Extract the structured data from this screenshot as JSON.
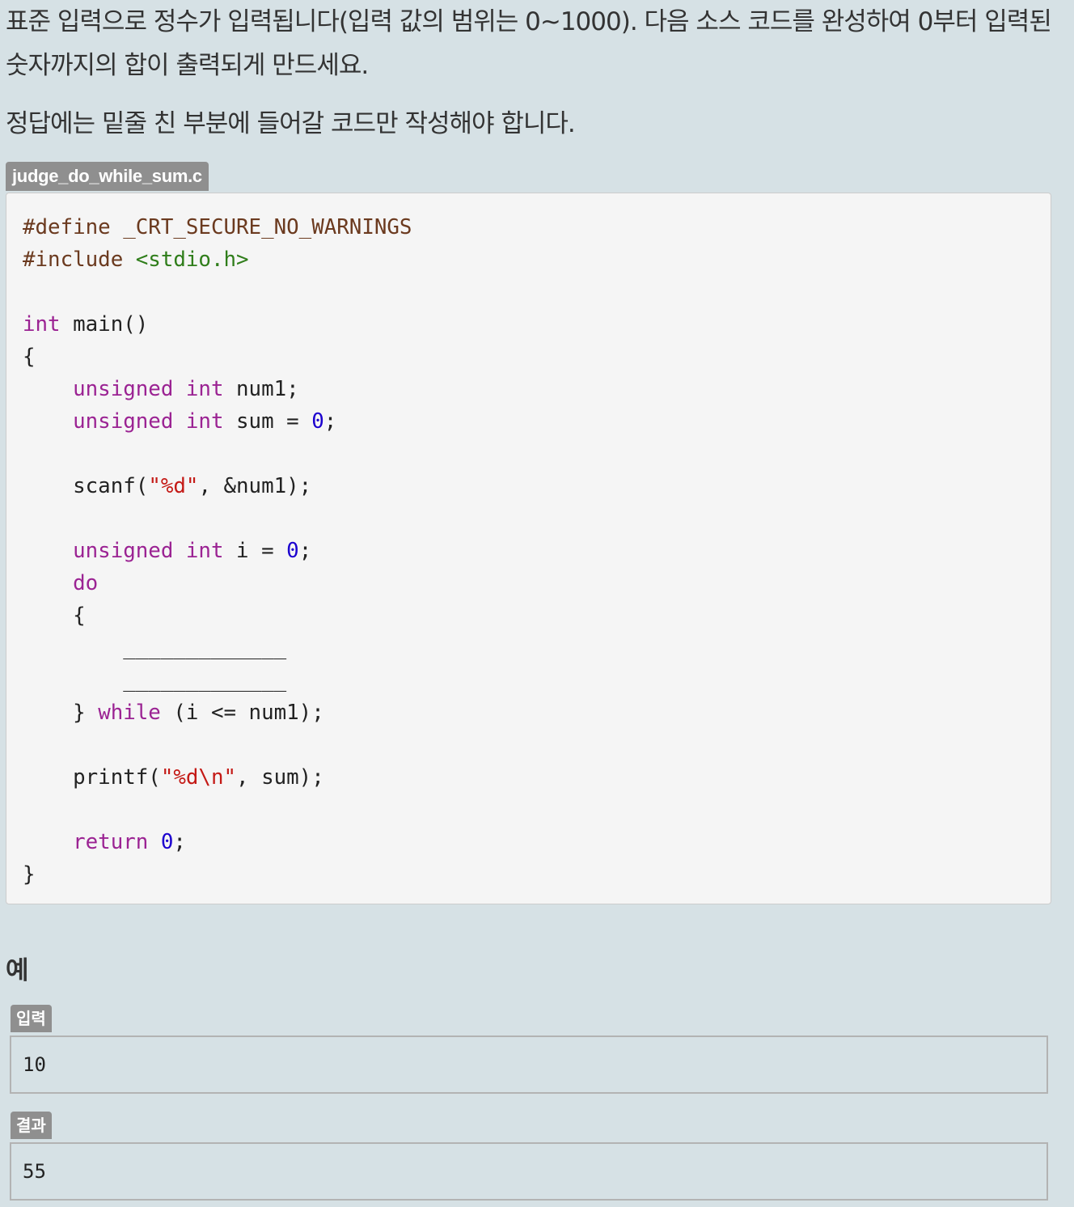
{
  "description": {
    "line1": "표준 입력으로 정수가 입력됩니다(입력 값의 범위는 0~1000). 다음 소스 코드를 완성하여 0부터 입력된 숫자까지의 합이 출력되게 만드세요.",
    "line2": "정답에는 밑줄 친 부분에 들어갈 코드만 작성해야 합니다."
  },
  "code_file": {
    "filename": "judge_do_while_sum.c",
    "lines": [
      [
        {
          "t": "#define _CRT_SECURE_NO_WARNINGS",
          "c": "pp"
        }
      ],
      [
        {
          "t": "#include ",
          "c": "pp"
        },
        {
          "t": "<stdio.h>",
          "c": "inc"
        }
      ],
      [],
      [
        {
          "t": "int",
          "c": "kw"
        },
        {
          "t": " main()",
          "c": ""
        }
      ],
      [
        {
          "t": "{",
          "c": ""
        }
      ],
      [
        {
          "t": "    ",
          "c": ""
        },
        {
          "t": "unsigned",
          "c": "kw"
        },
        {
          "t": " ",
          "c": ""
        },
        {
          "t": "int",
          "c": "kw"
        },
        {
          "t": " num1;",
          "c": ""
        }
      ],
      [
        {
          "t": "    ",
          "c": ""
        },
        {
          "t": "unsigned",
          "c": "kw"
        },
        {
          "t": " ",
          "c": ""
        },
        {
          "t": "int",
          "c": "kw"
        },
        {
          "t": " sum = ",
          "c": ""
        },
        {
          "t": "0",
          "c": "num"
        },
        {
          "t": ";",
          "c": ""
        }
      ],
      [],
      [
        {
          "t": "    scanf(",
          "c": ""
        },
        {
          "t": "\"%d\"",
          "c": "str"
        },
        {
          "t": ", &num1);",
          "c": ""
        }
      ],
      [],
      [
        {
          "t": "    ",
          "c": ""
        },
        {
          "t": "unsigned",
          "c": "kw"
        },
        {
          "t": " ",
          "c": ""
        },
        {
          "t": "int",
          "c": "kw"
        },
        {
          "t": " i = ",
          "c": ""
        },
        {
          "t": "0",
          "c": "num"
        },
        {
          "t": ";",
          "c": ""
        }
      ],
      [
        {
          "t": "    ",
          "c": ""
        },
        {
          "t": "do",
          "c": "kw"
        }
      ],
      [
        {
          "t": "    {",
          "c": ""
        }
      ],
      [
        {
          "t": "        _____________",
          "c": "blank"
        }
      ],
      [
        {
          "t": "        _____________",
          "c": "blank"
        }
      ],
      [
        {
          "t": "    } ",
          "c": ""
        },
        {
          "t": "while",
          "c": "kw"
        },
        {
          "t": " (i <= num1);",
          "c": ""
        }
      ],
      [],
      [
        {
          "t": "    printf(",
          "c": ""
        },
        {
          "t": "\"%d\\n\"",
          "c": "str"
        },
        {
          "t": ", sum);",
          "c": ""
        }
      ],
      [],
      [
        {
          "t": "    ",
          "c": ""
        },
        {
          "t": "return",
          "c": "kw"
        },
        {
          "t": " ",
          "c": ""
        },
        {
          "t": "0",
          "c": "num"
        },
        {
          "t": ";",
          "c": ""
        }
      ],
      [
        {
          "t": "}",
          "c": ""
        }
      ]
    ]
  },
  "example": {
    "heading": "예",
    "input_label": "입력",
    "input_value": "10",
    "output_label": "결과",
    "output_value": "55"
  }
}
